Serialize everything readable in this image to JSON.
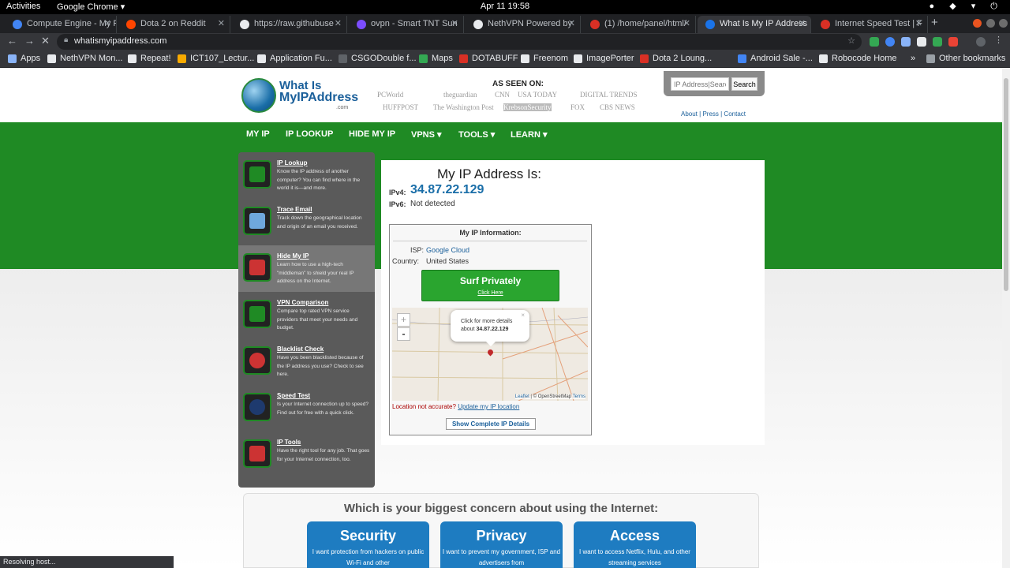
{
  "system": {
    "activities": "Activities",
    "app": "Google Chrome ▾",
    "clock": "Apr 11  19:58"
  },
  "tabs": [
    {
      "label": "Compute Engine - My F",
      "color": "#4285f4"
    },
    {
      "label": "Dota 2 on Reddit",
      "color": "#ff4500"
    },
    {
      "label": "https://raw.githubuse",
      "color": "#e8eaed"
    },
    {
      "label": "ovpn - Smart TNT Sun",
      "color": "#7c4dff"
    },
    {
      "label": "NethVPN Powered by",
      "color": "#e8eaed"
    },
    {
      "label": "(1) /home/panel/html/",
      "color": "#d93025"
    },
    {
      "label": "What Is My IP Address",
      "color": "#1a73e8"
    },
    {
      "label": "Internet Speed Test | F",
      "color": "#d93025"
    }
  ],
  "url": "whatismyipaddress.com",
  "bookmarks": [
    {
      "label": "Apps",
      "color": "#8ab4f8"
    },
    {
      "label": "NethVPN Mon...",
      "color": "#e8eaed"
    },
    {
      "label": "Repeat!",
      "color": "#e8eaed"
    },
    {
      "label": "ICT107_Lectur...",
      "color": "#f9ab00"
    },
    {
      "label": "Application Fu...",
      "color": "#e8eaed"
    },
    {
      "label": "CSGODouble f...",
      "color": "#5f6368"
    },
    {
      "label": "Maps",
      "color": "#34a853"
    },
    {
      "label": "DOTABUFF",
      "color": "#d93025"
    },
    {
      "label": "Freenom",
      "color": "#e8eaed"
    },
    {
      "label": "ImagePorter",
      "color": "#e8eaed"
    },
    {
      "label": "Dota 2 Loung...",
      "color": "#d93025"
    },
    {
      "label": "Android Sale -...",
      "color": "#4285f4"
    },
    {
      "label": "Robocode Home",
      "color": "#e8eaed"
    },
    {
      "label": "»",
      "color": "#35363a"
    },
    {
      "label": "Other bookmarks",
      "color": "#9aa0a6"
    }
  ],
  "site": {
    "logo_line1": "What Is",
    "logo_line2": "MyIPAddress",
    "logo_com": ".com",
    "as_seen_on": "AS SEEN ON:",
    "press": [
      "PCWorld",
      "theguardian",
      "CNN",
      "USA TODAY",
      "DIGITAL TRENDS",
      "HUFFPOST",
      "The Washington Post",
      "KrebsonSecurity",
      "FOX",
      "CBS NEWS"
    ],
    "search_placeholder": "IP Address|Search",
    "search_button": "Search",
    "top_links": [
      "About",
      "Press",
      "Contact"
    ],
    "nav": [
      "MY IP",
      "IP LOOKUP",
      "HIDE MY IP",
      "VPNS ▾",
      "TOOLS ▾",
      "LEARN ▾"
    ]
  },
  "sidebar": [
    {
      "title": "IP Lookup",
      "desc": "Know the IP address of another computer? You can find where in the world it is—and more.",
      "color": "#1f8a24"
    },
    {
      "title": "Trace Email",
      "desc": "Track down the geographical location and origin of an email you received.",
      "color": "#6fa8dc"
    },
    {
      "title": "Hide My IP",
      "desc": "Learn how to use a high-tech \"middleman\" to shield your real IP address on the Internet.",
      "color": "#cc3333"
    },
    {
      "title": "VPN Comparison",
      "desc": "Compare top rated VPN service providers that meet your needs and budget.",
      "color": "#1f8a24"
    },
    {
      "title": "Blacklist Check",
      "desc": "Have you been blacklisted because of the IP address you use? Check to see here.",
      "color": "#cc3333"
    },
    {
      "title": "Speed Test",
      "desc": "Is your Internet connection up to speed? Find out for free with a quick click.",
      "color": "#1e3a6e"
    },
    {
      "title": "IP Tools",
      "desc": "Have the right tool for any job. That goes for your Internet connection, too.",
      "color": "#cc3333"
    }
  ],
  "ip": {
    "heading": "My IP Address Is:",
    "ipv4_label": "IPv4:",
    "ipv4": "34.87.22.129",
    "ipv6_label": "IPv6:",
    "ipv6": "Not detected",
    "info_heading": "My IP Information:",
    "isp_label": "ISP:",
    "isp": "Google Cloud",
    "country_label": "Country:",
    "country": "United States",
    "surf_title": "Surf Privately",
    "surf_link": "Click Here",
    "popup_line1": "Click for more details",
    "popup_line2_prefix": "about",
    "popup_ip": "34.87.22.129",
    "zoom_in": "+",
    "zoom_out": "-",
    "map_attr_leaflet": "Leaflet",
    "map_attr_osm": "| © OpenStreetMap",
    "map_attr_terms": "Terms",
    "loc_question": "Location not accurate?",
    "loc_link": "Update my IP location",
    "show_button": "Show Complete IP Details"
  },
  "concern": {
    "question": "Which is your biggest concern about using the Internet:",
    "cards": [
      {
        "title": "Security",
        "desc": "I want protection from hackers on public Wi-Fi and other"
      },
      {
        "title": "Privacy",
        "desc": "I want to prevent my government, ISP and advertisers from"
      },
      {
        "title": "Access",
        "desc": "I want to access Netflix, Hulu, and other streaming services"
      }
    ]
  },
  "status": "Resolving host..."
}
